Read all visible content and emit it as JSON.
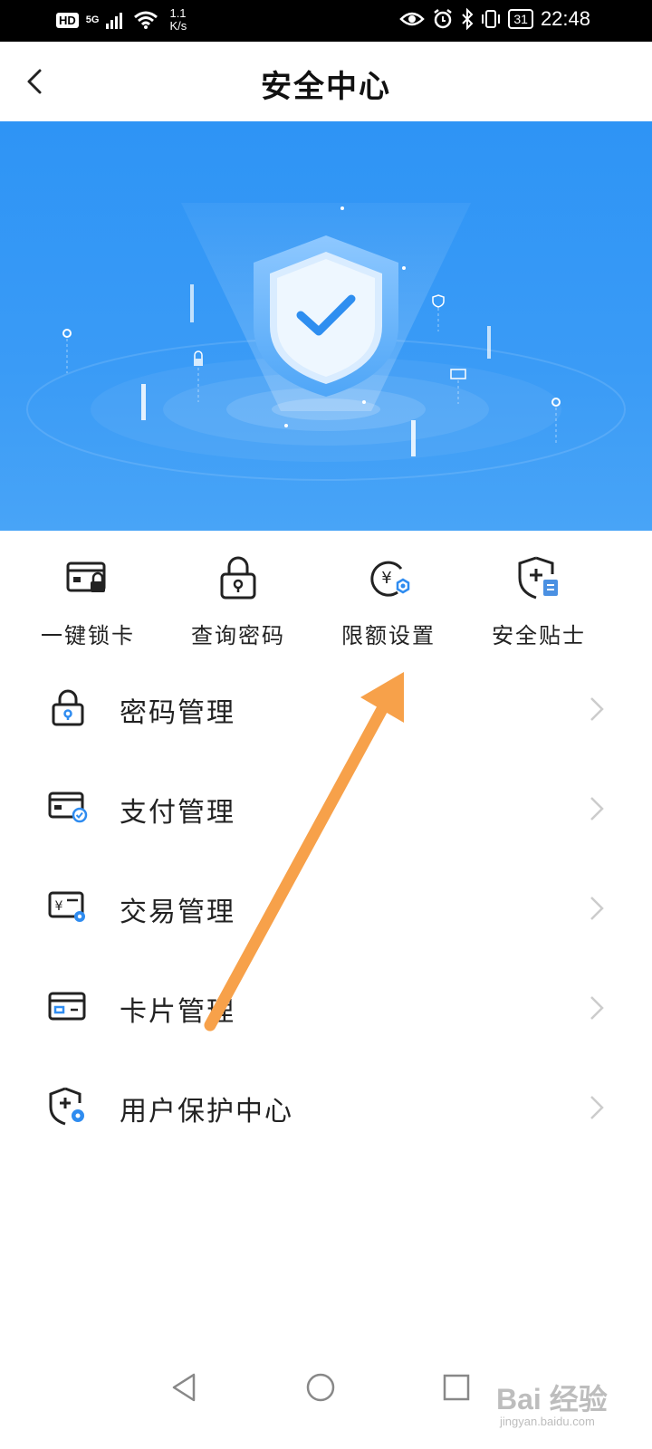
{
  "status_bar": {
    "network_badge": "HD",
    "signal_label": "5G",
    "speed_value": "1.1",
    "speed_unit": "K/s",
    "battery": "31",
    "time": "22:48"
  },
  "header": {
    "title": "安全中心"
  },
  "quick_actions": [
    {
      "label": "一键锁卡",
      "icon": "card-lock-icon"
    },
    {
      "label": "查询密码",
      "icon": "padlock-icon"
    },
    {
      "label": "限额设置",
      "icon": "yuan-limit-icon"
    },
    {
      "label": "安全贴士",
      "icon": "shield-tips-icon"
    }
  ],
  "menu": {
    "items": [
      {
        "label": "密码管理",
        "icon": "lock-icon"
      },
      {
        "label": "支付管理",
        "icon": "payment-card-icon"
      },
      {
        "label": "交易管理",
        "icon": "transaction-icon"
      },
      {
        "label": "卡片管理",
        "icon": "bank-card-icon"
      },
      {
        "label": "用户保护中心",
        "icon": "shield-gear-icon"
      }
    ]
  },
  "watermark": {
    "brand": "Bai 经验",
    "url": "jingyan.baidu.com"
  },
  "colors": {
    "accent": "#2e94f5",
    "annotation_arrow": "#f7a14a"
  }
}
